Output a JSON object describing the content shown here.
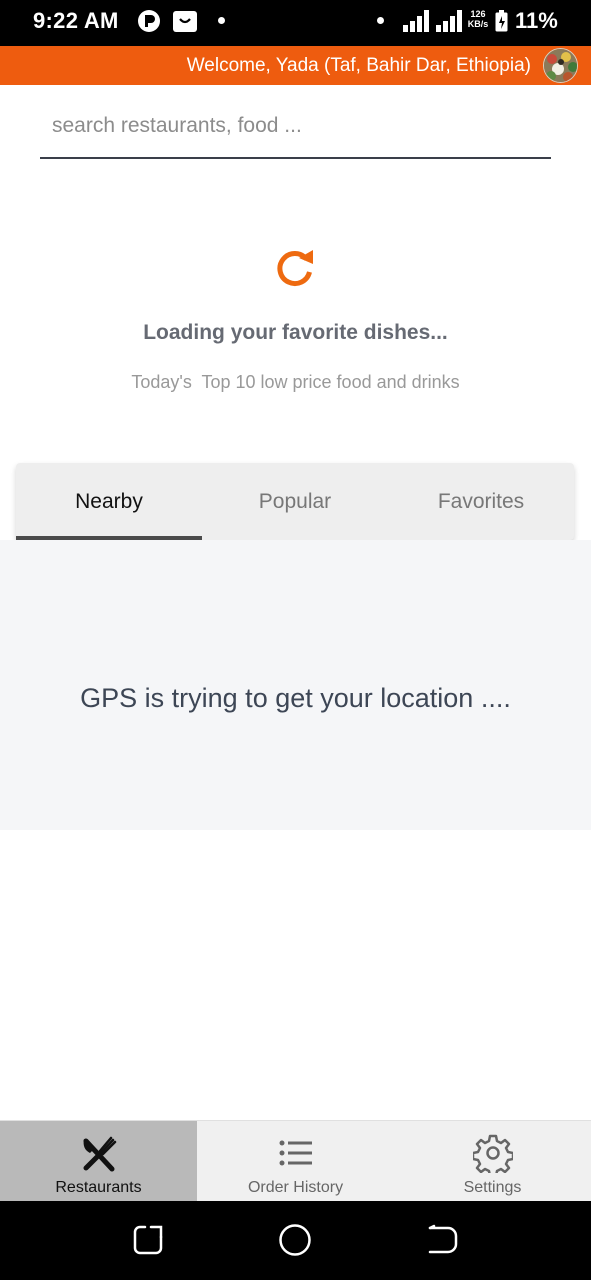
{
  "status_bar": {
    "time": "9:22 AM",
    "network_speed_value": "126",
    "network_speed_unit": "KB/s",
    "battery_percent": "11%"
  },
  "header": {
    "welcome_text": "Welcome, Yada (Taf, Bahir Dar, Ethiopia)",
    "accent_color": "#EE5C0F"
  },
  "search": {
    "placeholder": "search restaurants, food ...",
    "value": ""
  },
  "loading": {
    "icon": "refresh-icon",
    "title": "Loading your favorite dishes...",
    "subtitle": "Today's  Top 10 low price food and drinks"
  },
  "tabs": [
    {
      "label": "Nearby",
      "active": true
    },
    {
      "label": "Popular",
      "active": false
    },
    {
      "label": "Favorites",
      "active": false
    }
  ],
  "gps_message": "GPS is trying to get your location ....",
  "bottom_nav": [
    {
      "label": "Restaurants",
      "icon": "fork-knife-icon",
      "active": true
    },
    {
      "label": "Order History",
      "icon": "list-icon",
      "active": false
    },
    {
      "label": "Settings",
      "icon": "gear-icon",
      "active": false
    }
  ],
  "system_nav": [
    "recent-apps-icon",
    "home-icon",
    "back-icon"
  ]
}
